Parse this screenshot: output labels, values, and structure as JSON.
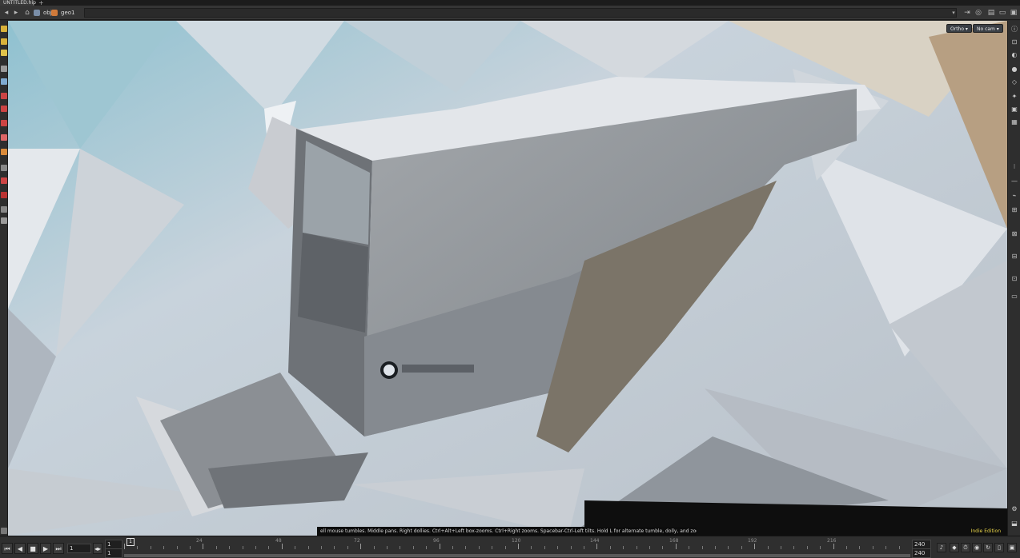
{
  "window": {
    "tab_title": "UNTITLED.hip",
    "new_tab": "+"
  },
  "pathbar": {
    "segments": [
      {
        "label": "obj",
        "color": "#7a8ea8"
      },
      {
        "label": "geo1",
        "color": "#d07a3a"
      }
    ],
    "dropdown_icon": "chevron-down-icon"
  },
  "viewport": {
    "camera_button": "Ortho ▾",
    "cam_menu": "No cam ▾",
    "hint_text": "ell mouse tumbles. Middle pans. Right dollies. Ctrl+Alt+Left box-zooms. Ctrl+Right zooms. Spacebar-Ctrl-Left tilts. Hold L for alternate tumble, dolly, and zoom.",
    "edition_label": "Indie Edition",
    "scene": "photogrammetry mesh of concrete vault entrance on snowy hillside",
    "colors": {
      "sky": "#cdd4db",
      "concrete": "#8e9297",
      "accent_teal": "#7fb8c9"
    }
  },
  "timeline": {
    "controls": [
      "⏮",
      "◀",
      "■",
      "▶",
      "⏭"
    ],
    "current_frame": "1",
    "start_frame": "1",
    "start_frame_b": "1",
    "playhead_label": "1",
    "ticks": [
      "24",
      "48",
      "72",
      "96",
      "120",
      "144",
      "168",
      "192",
      "216"
    ],
    "end_frame": "240",
    "end_frame_b": "240"
  }
}
